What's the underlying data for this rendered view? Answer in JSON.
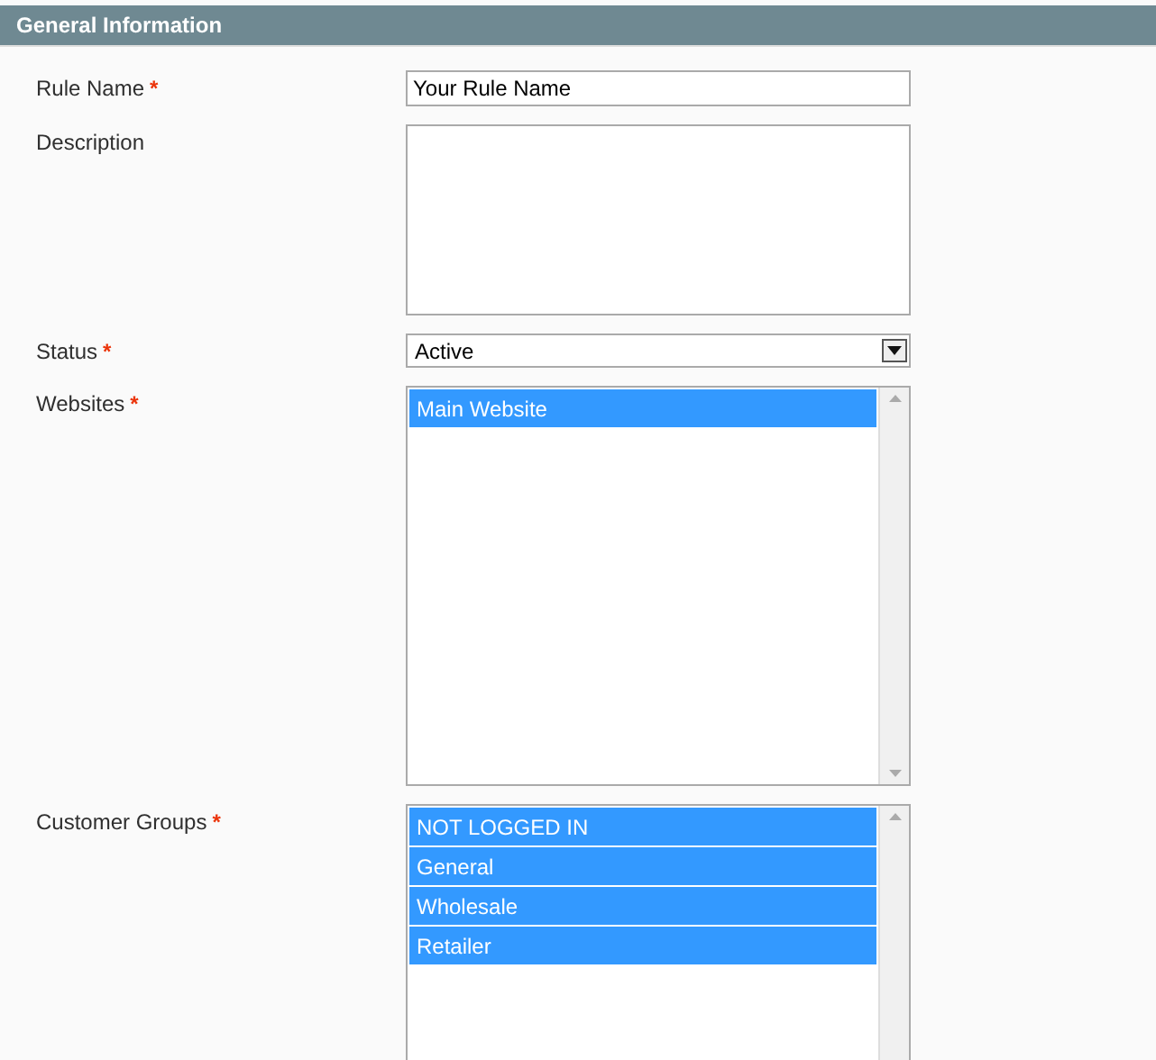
{
  "section": {
    "title": "General Information"
  },
  "fields": [
    {
      "kind": "text",
      "label": "Rule Name",
      "required_mark": "*",
      "value": "Your Rule Name"
    },
    {
      "kind": "textarea",
      "label": "Description"
    },
    {
      "kind": "select",
      "label": "Status",
      "required_mark": "*",
      "value": "Active"
    },
    {
      "kind": "multiselect",
      "label": "Websites",
      "required_mark": "*",
      "options": [
        {
          "label": "Main Website",
          "selected": true
        }
      ]
    },
    {
      "kind": "multiselect",
      "label": "Customer Groups",
      "required_mark": "*",
      "options": [
        {
          "label": "NOT LOGGED IN",
          "selected": true
        },
        {
          "label": "General",
          "selected": true
        },
        {
          "label": "Wholesale",
          "selected": true
        },
        {
          "label": "Retailer",
          "selected": true
        }
      ]
    }
  ]
}
